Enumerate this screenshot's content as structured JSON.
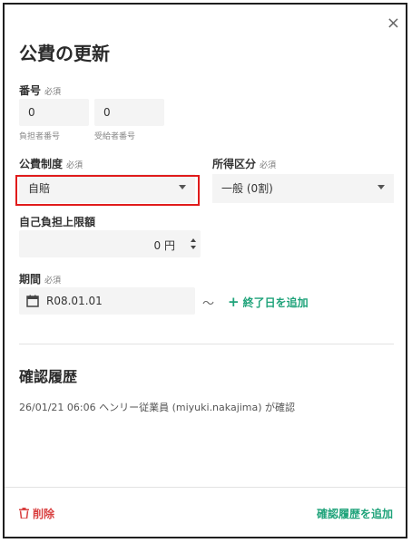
{
  "dialog": {
    "title": "公費の更新",
    "close_label": "×"
  },
  "number": {
    "label": "番号",
    "required": "必須",
    "payer_value": "0",
    "payer_caption": "負担者番号",
    "recipient_value": "0",
    "recipient_caption": "受給者番号"
  },
  "public_expense_system": {
    "label": "公費制度",
    "required": "必須",
    "selected": "自賠"
  },
  "income_category": {
    "label": "所得区分",
    "required": "必須",
    "selected": "一般 (0割)"
  },
  "copay_limit": {
    "label": "自己負担上限額",
    "value": "0",
    "unit": "円"
  },
  "period": {
    "label": "期間",
    "required": "必須",
    "start_date": "R08.01.01",
    "separator": "〜",
    "add_end_date": "終了日を追加"
  },
  "history": {
    "title": "確認履歴",
    "entries": [
      "26/01/21 06:06 ヘンリー従業員 (miyuki.nakajima) が確認"
    ]
  },
  "footer": {
    "delete_label": "削除",
    "add_history_label": "確認履歴を追加"
  },
  "colors": {
    "accent_green": "#1fa37a",
    "danger_red": "#d94040",
    "highlight_red": "#e01b1b"
  }
}
